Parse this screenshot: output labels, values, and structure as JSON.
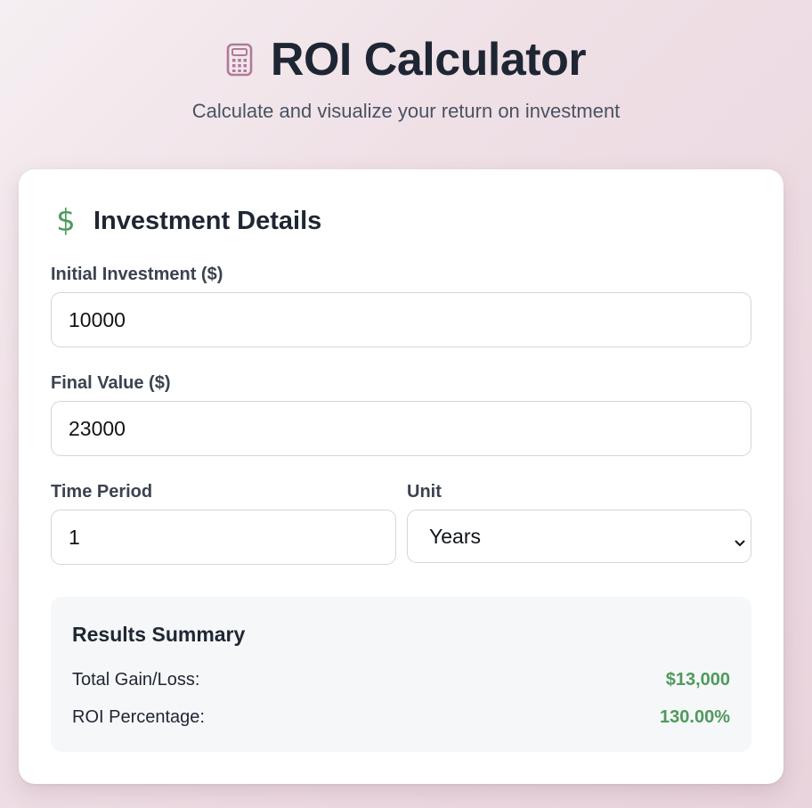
{
  "header": {
    "title": "ROI Calculator",
    "subtitle": "Calculate and visualize your return on investment",
    "icon": "calculator-icon"
  },
  "details": {
    "section_title": "Investment Details",
    "section_icon": "dollar-icon",
    "initial_investment": {
      "label": "Initial Investment ($)",
      "value": "10000"
    },
    "final_value": {
      "label": "Final Value ($)",
      "value": "23000"
    },
    "time_period": {
      "label": "Time Period",
      "value": "1"
    },
    "unit": {
      "label": "Unit",
      "selected": "Years"
    }
  },
  "results": {
    "title": "Results Summary",
    "gain_label": "Total Gain/Loss:",
    "gain_value": "$13,000",
    "roi_label": "ROI Percentage:",
    "roi_value": "130.00%"
  },
  "colors": {
    "accent_green": "#4f9a5c",
    "icon_mauve": "#b07a9a",
    "text_dark": "#1f2633"
  }
}
